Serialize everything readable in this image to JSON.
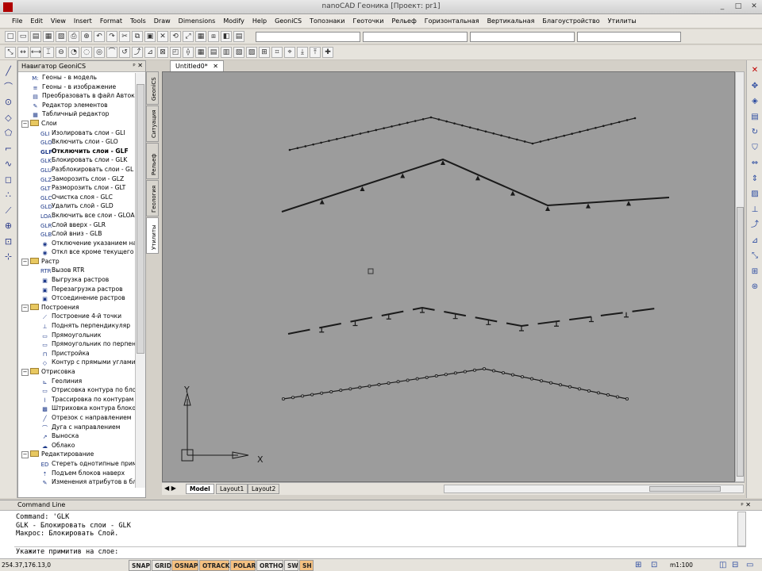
{
  "app": {
    "title": "nanoCAD Геоника [Проект: pr1]"
  },
  "menu": {
    "items": [
      "File",
      "Edit",
      "View",
      "Insert",
      "Format",
      "Tools",
      "Draw",
      "Dimensions",
      "Modify",
      "Help",
      "GeoniCS",
      "Топознаки",
      "Геоточки",
      "Рельеф",
      "Горизонтальная",
      "Вертикальная",
      "Благоустройство",
      "Утилиты"
    ]
  },
  "navigator": {
    "title": "Навигатор GeoniCS",
    "items": [
      {
        "text": "Геоны - в модель",
        "icon": "M:"
      },
      {
        "text": "Геоны - в изображение",
        "icon": "≡"
      },
      {
        "text": "Преобразовать в файл Автока",
        "icon": "▤"
      },
      {
        "text": "Редактор элементов",
        "icon": "✎"
      },
      {
        "text": "Табличный редактор",
        "icon": "▦"
      },
      {
        "text": "Слои",
        "group": true
      },
      {
        "text": "Изолировать слои - GLI",
        "icon": "GLI"
      },
      {
        "text": "Включить слои - GLO",
        "icon": "GLO"
      },
      {
        "text": "Отключить слои - GLF",
        "icon": "GLF",
        "bold": true
      },
      {
        "text": "Блокировать слои - GLK",
        "icon": "GLK"
      },
      {
        "text": "Разблокировать слои - GL",
        "icon": "GLU"
      },
      {
        "text": "Заморозить слои - GLZ",
        "icon": "GLZ"
      },
      {
        "text": "Разморозить слои - GLT",
        "icon": "GLT"
      },
      {
        "text": "Очистка слоя - GLC",
        "icon": "GLC"
      },
      {
        "text": "Удалить слой - GLD",
        "icon": "GLD"
      },
      {
        "text": "Включить все слои - GLOA",
        "icon": "LOA"
      },
      {
        "text": "Слой вверх - GLR",
        "icon": "GLR"
      },
      {
        "text": "Слой вниз - GLB",
        "icon": "GLB"
      },
      {
        "text": "Отключение указанием на",
        "icon": "◉"
      },
      {
        "text": "Откл все кроме текущего",
        "icon": "◉"
      },
      {
        "text": "Растр",
        "group": true
      },
      {
        "text": "Вызов RTR",
        "icon": "RTR"
      },
      {
        "text": "Выгрузка растров",
        "icon": "▣"
      },
      {
        "text": "Перезагрузка растров",
        "icon": "▣"
      },
      {
        "text": "Отсоединение растров",
        "icon": "▣"
      },
      {
        "text": "Построения",
        "group": true
      },
      {
        "text": "Построение 4-й точки",
        "icon": "⟋"
      },
      {
        "text": "Поднять перпендикуляр",
        "icon": "⊥"
      },
      {
        "text": "Прямоугольник",
        "icon": "▭"
      },
      {
        "text": "Прямоугольник по перпенд",
        "icon": "▭"
      },
      {
        "text": "Пристройка",
        "icon": "⊓"
      },
      {
        "text": "Контур с прямыми углами",
        "icon": "◇"
      },
      {
        "text": "Отрисовка",
        "group": true
      },
      {
        "text": "Геолиния",
        "icon": "⊾"
      },
      {
        "text": "Отрисовка контура по бло",
        "icon": "▭"
      },
      {
        "text": "Трассировка по контурам",
        "icon": "⌇"
      },
      {
        "text": "Штриховка контура блоко",
        "icon": "▩"
      },
      {
        "text": "Отрезок с направлением",
        "icon": "╱"
      },
      {
        "text": "Дуга с направлением",
        "icon": "⌒"
      },
      {
        "text": "Выноска",
        "icon": "↗"
      },
      {
        "text": "Облако",
        "icon": "☁"
      },
      {
        "text": "Редактирование",
        "group": true
      },
      {
        "text": "Стереть однотипные прим",
        "icon": "ED"
      },
      {
        "text": "Подъем блоков наверх",
        "icon": "⇡"
      },
      {
        "text": "Изменения атрибутов в бл",
        "icon": "✎"
      }
    ]
  },
  "side_tabs": [
    "GeoniCS",
    "Ситуация",
    "Рельеф",
    "Геология",
    "Утилиты"
  ],
  "document": {
    "tab": "Untitled0*",
    "layouts": [
      "Model",
      "Layout1",
      "Layout2"
    ]
  },
  "canvas": {
    "ucs_y": "Y",
    "ucs_x": "X"
  },
  "command_line": {
    "title": "Command Line",
    "lines": [
      "Command: 'GLK",
      "GLK - Блокировать слои - GLK",
      "Макрос: Блокировать Слой."
    ],
    "prompt": "Укажите примитив на слое:"
  },
  "status": {
    "coords": "254.37,176.13,0",
    "buttons": [
      {
        "label": "SNAP",
        "on": false
      },
      {
        "label": "GRID",
        "on": false
      },
      {
        "label": "OSNAP",
        "on": true
      },
      {
        "label": "OTRACK",
        "on": true
      },
      {
        "label": "POLAR",
        "on": true
      },
      {
        "label": "ORTHO",
        "on": false
      },
      {
        "label": "SW",
        "on": false
      },
      {
        "label": "SH",
        "on": true
      }
    ],
    "scale": "m1:100"
  },
  "colors": {
    "canvas_bg": "#9c9c9c",
    "line": "#1a1a1a",
    "status_on": "#f4c080"
  }
}
